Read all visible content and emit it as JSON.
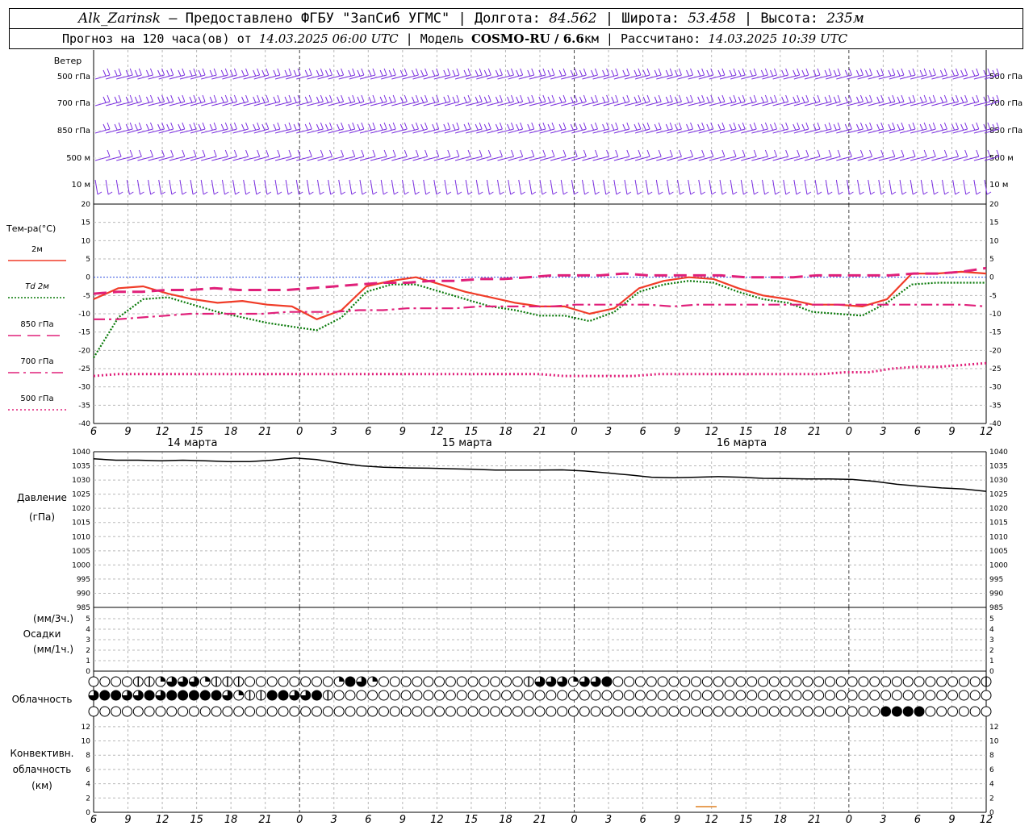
{
  "header": {
    "station": "Alk_Zarinsk",
    "provided": "– Предоставлено ФГБУ \"ЗапСиб УГМС\" | Долгота:",
    "lon": "84.562",
    "lat_label": "| Широта:",
    "lat": "53.458",
    "alt_label": "| Высота:",
    "alt": "235м",
    "forecast_label": "Прогноз на 120 часа(ов) от",
    "start": "14.03.2025 06:00 UTC",
    "model_label": "| Модель",
    "model": "COSMO-RU / 6.6",
    "model_unit": "км",
    "calc_label": "| Рассчитано:",
    "calc": "14.03.2025 10:39 UTC"
  },
  "colors": {
    "wind": "#7a2ee0",
    "t2m": "#f03c28",
    "td2m": "#0a7a0a",
    "t850": "#e0207a",
    "pressure": "#000000",
    "zero_line": "#3050e0",
    "conv": "#e08020"
  },
  "chart_data": [
    {
      "type": "wind-barbs",
      "title": "Ветер",
      "levels": [
        "500 гПа",
        "700 гПа",
        "850 гПа",
        "500 м",
        "10 м"
      ],
      "x_hours": [
        6,
        9,
        12,
        15,
        18,
        21,
        0,
        3,
        6,
        9,
        12,
        15,
        18,
        21,
        0,
        3,
        6,
        9,
        12,
        15,
        18,
        21,
        0,
        3,
        6,
        9,
        12
      ]
    },
    {
      "type": "line",
      "ylabel": "Тем-ра(°C)",
      "ylim": [
        -40,
        20
      ],
      "yticks": [
        20,
        15,
        10,
        5,
        0,
        -5,
        -10,
        -15,
        -20,
        -25,
        -30,
        -35,
        -40
      ],
      "xticks": [
        "6",
        "9",
        "12",
        "15",
        "18",
        "21",
        "0",
        "3",
        "6",
        "9",
        "12",
        "15",
        "18",
        "21",
        "0",
        "3",
        "6",
        "9",
        "12",
        "15",
        "18",
        "21",
        "0",
        "3",
        "6",
        "9",
        "12"
      ],
      "date_labels": [
        "14 марта",
        "15 марта",
        "16 марта"
      ],
      "series": [
        {
          "name": "2м",
          "style": "solid",
          "values": [
            -6,
            -3,
            -2.5,
            -4.5,
            -6,
            -7,
            -6.5,
            -7.5,
            -8,
            -11.5,
            -9,
            -2.5,
            -1,
            0,
            -2,
            -4,
            -5.5,
            -7,
            -8,
            -8,
            -10,
            -8.5,
            -3,
            -1,
            0,
            -0.5,
            -3,
            -5,
            -6,
            -7.5,
            -7.5,
            -8,
            -6,
            1,
            1,
            1.5,
            1
          ]
        },
        {
          "name": "Td 2м",
          "style": "dotted",
          "values": [
            -22,
            -11,
            -6,
            -5.5,
            -7.5,
            -9.5,
            -11,
            -12.5,
            -13.5,
            -14.5,
            -11,
            -4,
            -2,
            -2,
            -4,
            -6,
            -8,
            -9,
            -10.5,
            -10.5,
            -12,
            -9.5,
            -4,
            -2,
            -1,
            -1.5,
            -4,
            -6,
            -7,
            -9.5,
            -10,
            -10.5,
            -7,
            -2,
            -1.5,
            -1.5,
            -1.5
          ]
        },
        {
          "name": "850 гПа",
          "style": "dashed",
          "values": [
            -4.5,
            -4,
            -4,
            -3.5,
            -3.5,
            -3,
            -3.5,
            -3.5,
            -3.5,
            -3,
            -2.5,
            -2,
            -1.5,
            -1.5,
            -1,
            -1,
            -0.5,
            -0.5,
            0,
            0.5,
            0.5,
            0.5,
            1,
            0.5,
            0.5,
            0.5,
            0.5,
            0,
            0,
            0,
            0.5,
            0.5,
            0.5,
            0.5,
            1,
            1,
            1.5,
            2.5
          ]
        },
        {
          "name": "700 гПа",
          "style": "dashdot",
          "values": [
            -11.5,
            -11.5,
            -11,
            -10.5,
            -10,
            -10,
            -10,
            -10,
            -9.5,
            -9.5,
            -9.5,
            -9,
            -9,
            -8.5,
            -8.5,
            -8.5,
            -8,
            -8,
            -8,
            -8,
            -7.5,
            -7.5,
            -7.5,
            -7.5,
            -8,
            -7.5,
            -7.5,
            -7.5,
            -7.5,
            -7.5,
            -7.5,
            -7.5,
            -7.5,
            -7.5,
            -7.5,
            -7.5,
            -7.5,
            -8
          ]
        },
        {
          "name": "500 гПа",
          "style": "dotted-thick",
          "values": [
            -27,
            -26.5,
            -26.5,
            -26.5,
            -26.5,
            -26.5,
            -26.5,
            -26.5,
            -26.5,
            -26.5,
            -26.5,
            -26.5,
            -26.5,
            -26.5,
            -26.5,
            -26.5,
            -26.5,
            -26.5,
            -26.5,
            -26.5,
            -27,
            -27,
            -27,
            -27,
            -26.5,
            -26.5,
            -26.5,
            -26.5,
            -26.5,
            -26.5,
            -26.5,
            -26.5,
            -26,
            -26,
            -25,
            -24.5,
            -24.5,
            -24,
            -23.5
          ]
        }
      ]
    },
    {
      "type": "line",
      "title": "Давление",
      "ylabel": "(гПа)",
      "ylim": [
        985,
        1040
      ],
      "yticks": [
        1040,
        1035,
        1030,
        1025,
        1020,
        1015,
        1010,
        1005,
        1000,
        995,
        990,
        985
      ],
      "series": [
        {
          "name": "Давление",
          "values": [
            1037.5,
            1037,
            1037,
            1036.8,
            1037,
            1036.8,
            1036.5,
            1036.5,
            1037,
            1037.8,
            1037.2,
            1036,
            1035,
            1034.5,
            1034.3,
            1034.2,
            1034,
            1033.8,
            1033.5,
            1033.5,
            1033.5,
            1033.6,
            1033.2,
            1032.5,
            1031.8,
            1031,
            1030.8,
            1031,
            1031.2,
            1031,
            1030.6,
            1030.5,
            1030.4,
            1030.4,
            1030.2,
            1029.5,
            1028.5,
            1027.8,
            1027.2,
            1026.8,
            1026
          ]
        }
      ]
    },
    {
      "type": "bar",
      "title": "Осадки",
      "ylabel": "(мм/3ч.)",
      "ylabel2": "(мм/1ч.)",
      "ylim": [
        0,
        5
      ],
      "yticks": [
        5,
        4,
        3,
        2,
        1,
        0
      ],
      "values": []
    },
    {
      "type": "table",
      "title": "Облачность",
      "rows": [
        "000011233321110000000024320000000000000133323340000000000000000000000000000000001",
        "344334344444321144334100000000000000000000000000000000000000000000000000000000000",
        "000000000000000000000000000000000000000000000000000000000000000000000004444000000"
      ]
    },
    {
      "type": "bar",
      "title": "Конвективн.",
      "ylabel": "облачность",
      "ylabel2": "(км)",
      "ylim": [
        0,
        13
      ],
      "yticks": [
        12,
        10,
        8,
        6,
        4,
        2,
        0
      ],
      "values": []
    }
  ]
}
